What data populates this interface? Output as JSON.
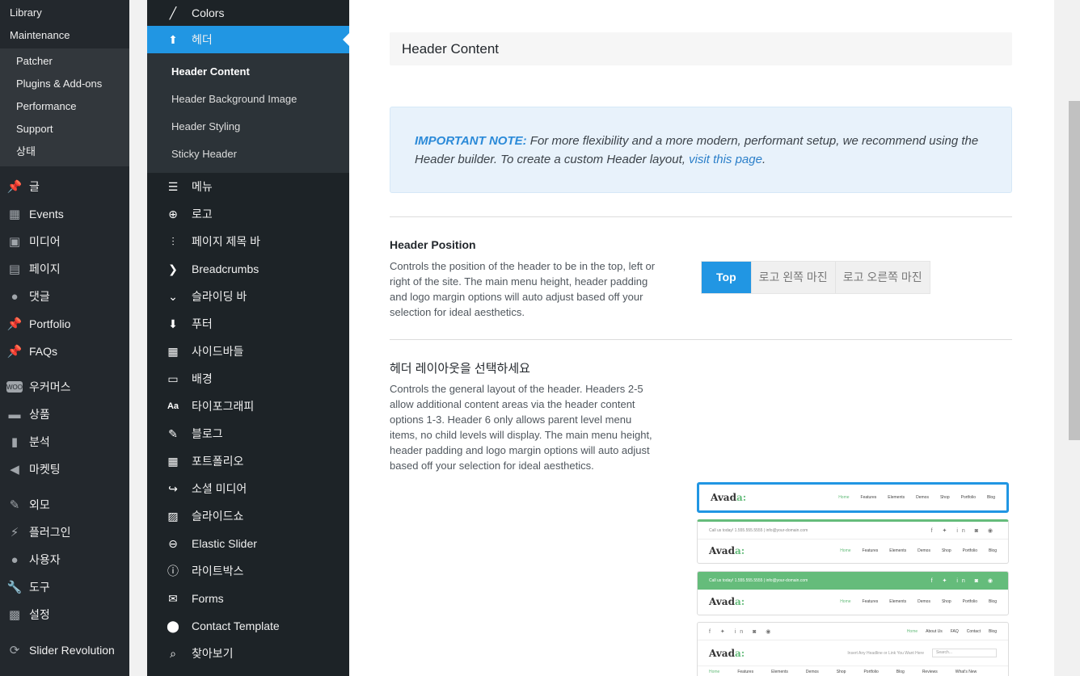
{
  "wp_sidebar": {
    "top_sub": [
      "Library",
      "Maintenance"
    ],
    "sub": [
      "Patcher",
      "Plugins & Add-ons",
      "Performance",
      "Support",
      "상태"
    ],
    "menu": [
      {
        "label": "글",
        "icon": "pin-icon"
      },
      {
        "label": "Events",
        "icon": "calendar-icon"
      },
      {
        "label": "미디어",
        "icon": "media-icon"
      },
      {
        "label": "페이지",
        "icon": "page-icon"
      },
      {
        "label": "댓글",
        "icon": "comment-icon"
      },
      {
        "label": "Portfolio",
        "icon": "pin-icon"
      },
      {
        "label": "FAQs",
        "icon": "pin-icon"
      },
      {
        "label": "우커머스",
        "icon": "woo-icon"
      },
      {
        "label": "상품",
        "icon": "archive-icon"
      },
      {
        "label": "분석",
        "icon": "bar-chart-icon"
      },
      {
        "label": "마켓팅",
        "icon": "megaphone-icon"
      },
      {
        "label": "외모",
        "icon": "brush-icon"
      },
      {
        "label": "플러그인",
        "icon": "plug-icon"
      },
      {
        "label": "사용자",
        "icon": "user-icon"
      },
      {
        "label": "도구",
        "icon": "wrench-icon"
      },
      {
        "label": "설정",
        "icon": "settings-icon"
      },
      {
        "label": "Slider Revolution",
        "icon": "refresh-icon"
      }
    ]
  },
  "avada_sidebar": {
    "colors": "Colors",
    "header": "헤더",
    "header_sub": [
      "Header Content",
      "Header Background Image",
      "Header Styling",
      "Sticky Header"
    ],
    "items": [
      {
        "label": "메뉴",
        "icon": "menu-icon"
      },
      {
        "label": "로고",
        "icon": "plus-circle-icon"
      },
      {
        "label": "페이지 제목 바",
        "icon": "sliders-icon"
      },
      {
        "label": "Breadcrumbs",
        "icon": "chevron-right-icon"
      },
      {
        "label": "슬라이딩 바",
        "icon": "chevron-down-icon"
      },
      {
        "label": "푸터",
        "icon": "arrow-down-icon"
      },
      {
        "label": "사이드바들",
        "icon": "sidebar-icon"
      },
      {
        "label": "배경",
        "icon": "monitor-icon"
      },
      {
        "label": "타이포그래피",
        "icon": "typography-icon"
      },
      {
        "label": "블로그",
        "icon": "edit-icon"
      },
      {
        "label": "포트폴리오",
        "icon": "grid-icon"
      },
      {
        "label": "소셜 미디어",
        "icon": "share-icon"
      },
      {
        "label": "슬라이드쇼",
        "icon": "image-icon"
      },
      {
        "label": "Elastic Slider",
        "icon": "minus-circle-icon"
      },
      {
        "label": "라이트박스",
        "icon": "info-icon"
      },
      {
        "label": "Forms",
        "icon": "envelope-icon"
      },
      {
        "label": "Contact Template",
        "icon": "location-icon"
      },
      {
        "label": "찾아보기",
        "icon": "search-icon"
      }
    ]
  },
  "main": {
    "section_title": "Header Content",
    "note": {
      "label": "IMPORTANT NOTE:",
      "text": " For more flexibility and a more modern, performant setup, we recommend using the Header builder. To create a custom Header layout, ",
      "link": "visit this page",
      "end": "."
    },
    "position": {
      "title": "Header Position",
      "desc": "Controls the position of the header to be in the top, left or right of the site. The main menu height, header padding and logo margin options will auto adjust based off your selection for ideal aesthetics.",
      "options": [
        "Top",
        "로고 왼쪽 마진",
        "로고 오른쪽 마진"
      ],
      "selected": "Top"
    },
    "layout": {
      "title": "헤더 레이아웃을 선택하세요",
      "desc": "Controls the general layout of the header. Headers 2-5 allow additional content areas via the header content options 1-3. Header 6 only allows parent level menu items, no child levels will display. The main menu height, header padding and logo margin options will auto adjust based off your selection for ideal aesthetics."
    },
    "preview": {
      "logo_main": "Avad",
      "logo_accent": "a:",
      "nav": [
        "Home",
        "Features",
        "Elements",
        "Demos",
        "Shop",
        "Portfolio",
        "Blog"
      ],
      "nav_wide": [
        "Home",
        "Features",
        "Elements",
        "Demos",
        "Shop",
        "Portfolio",
        "Blog",
        "Reviews",
        "What's New"
      ],
      "top_nav": [
        "Home",
        "About Us",
        "FAQ",
        "Contact",
        "Blog"
      ],
      "contact": "Call us today! 1.555.555.5555  |  info@your-domain.com",
      "social": "f ✦ in ◙ ◉",
      "ad_text": "Insert Any Headline or Link You Want Here",
      "search": "Search..."
    }
  },
  "colors": {
    "accent": "#2196e3",
    "green": "#65bc7b"
  }
}
